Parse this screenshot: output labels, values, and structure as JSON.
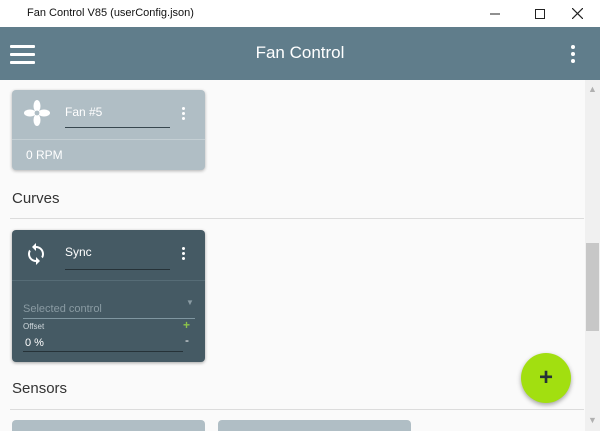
{
  "window": {
    "title": "Fan Control V85 (userConfig.json)"
  },
  "appbar": {
    "title": "Fan Control"
  },
  "fans": [
    {
      "name": "Fan #5",
      "rpm": "0 RPM"
    }
  ],
  "curves_section": {
    "title": "Curves"
  },
  "curves": [
    {
      "name": "Sync",
      "selected_control_placeholder": "Selected control",
      "offset_label": "Offset",
      "offset_value": "0 %",
      "plus": "+",
      "minus": "-"
    }
  ],
  "sensors_section": {
    "title": "Sensors"
  },
  "fab": {
    "icon": "+"
  },
  "colors": {
    "appbar": "#607d8b",
    "fan_card": "#b0bec5",
    "curve_card": "#455a64",
    "fab": "#a2df10",
    "accent_green": "#8bc34a"
  },
  "icons": {
    "menu": "hamburger-icon",
    "more": "vertical-dots-icon",
    "fan": "fan-icon",
    "sync": "sync-icon",
    "fab": "plus-icon"
  }
}
